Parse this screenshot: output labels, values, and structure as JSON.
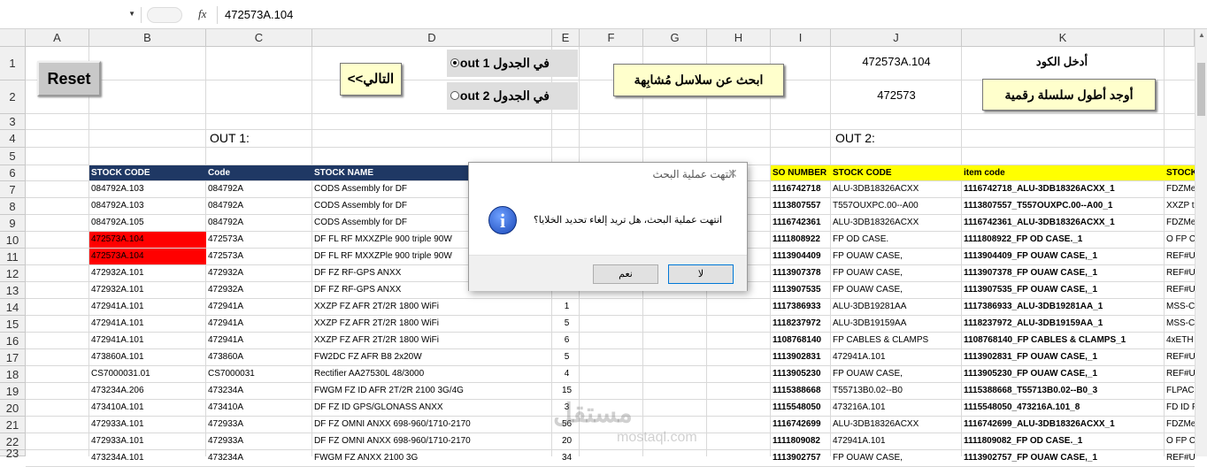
{
  "formula_bar": {
    "name_box": "",
    "fx": "fx",
    "formula": "472573A.104"
  },
  "columns": [
    "A",
    "B",
    "C",
    "D",
    "E",
    "F",
    "G",
    "H",
    "I",
    "J",
    "K"
  ],
  "rows": [
    "1",
    "2",
    "3",
    "4",
    "5",
    "6",
    "7",
    "8",
    "9",
    "10",
    "11",
    "12",
    "13",
    "14",
    "15",
    "16",
    "17",
    "18",
    "19",
    "20",
    "21",
    "22",
    "23"
  ],
  "controls": {
    "reset": "Reset",
    "next": "التالي>>",
    "radio1": "في الجدول out 1",
    "radio2": "في الجدول out 2",
    "search_similar": "ابحث عن سلاسل مُشابِهة",
    "enter_code": "أدخل الكود",
    "find_longest": "أوجد أطول سلسلة رقمية",
    "code_value": "472573A.104",
    "code_digits": "472573"
  },
  "labels": {
    "out1": "OUT 1:",
    "out2": "OUT 2:"
  },
  "out1": {
    "headers": [
      "STOCK CODE",
      "Code",
      "STOCK NAME"
    ],
    "rows": [
      [
        "084792A.103",
        "084792A",
        "CODS Assembly for DF",
        ""
      ],
      [
        "084792A.103",
        "084792A",
        "CODS Assembly for DF",
        ""
      ],
      [
        "084792A.105",
        "084792A",
        "CODS Assembly for DF",
        ""
      ],
      [
        "472573A.104",
        "472573A",
        "DF FL RF MXXZPle 900 triple 90W",
        ""
      ],
      [
        "472573A.104",
        "472573A",
        "DF FL RF MXXZPle 900 triple 90W",
        ""
      ],
      [
        "472932A.101",
        "472932A",
        "DF FZ RF-GPS ANXX",
        ""
      ],
      [
        "472932A.101",
        "472932A",
        "DF FZ RF-GPS ANXX",
        ""
      ],
      [
        "472941A.101",
        "472941A",
        "XXZP FZ AFR 2T/2R 1800 WiFi",
        "1"
      ],
      [
        "472941A.101",
        "472941A",
        "XXZP FZ AFR 2T/2R 1800 WiFi",
        "5"
      ],
      [
        "472941A.101",
        "472941A",
        "XXZP FZ AFR 2T/2R 1800 WiFi",
        "6"
      ],
      [
        "473860A.101",
        "473860A",
        "FW2DC FZ AFR B8 2x20W",
        "5"
      ],
      [
        "CS7000031.01",
        "CS7000031",
        "Rectifier AA27530L 48/3000",
        "4"
      ],
      [
        "473234A.206",
        "473234A",
        "FWGM FZ ID AFR 2T/2R 2100 3G/4G",
        "15"
      ],
      [
        "473410A.101",
        "473410A",
        "DF FZ ID GPS/GLONASS ANXX",
        "3"
      ],
      [
        "472933A.101",
        "472933A",
        "DF FZ OMNI ANXX 698-960/1710-2170",
        "56"
      ],
      [
        "472933A.101",
        "472933A",
        "DF FZ OMNI ANXX 698-960/1710-2170",
        "20"
      ],
      [
        "473234A.101",
        "473234A",
        "FWGM FZ ANXX 2100 3G",
        "34"
      ]
    ]
  },
  "out2": {
    "headers": [
      "SO NUMBER",
      "STOCK CODE",
      "item code",
      "STOCK"
    ],
    "rows": [
      [
        "1116742718",
        "ALU-3DB18326ACXX",
        "1116742718_ALU-3DB18326ACXX_1",
        "FDZMe"
      ],
      [
        "1113807557",
        "T557OUXPC.00--A00",
        "1113807557_T557OUXPC.00--A00_1",
        "XXZP t"
      ],
      [
        "1116742361",
        "ALU-3DB18326ACXX",
        "1116742361_ALU-3DB18326ACXX_1",
        "FDZMe"
      ],
      [
        "1111808922",
        "FP OD CASE.",
        "1111808922_FP OD CASE._1",
        "O FP C"
      ],
      [
        "1113904409",
        "FP OUAW CASE,",
        "1113904409_FP OUAW CASE,_1",
        "REF#U"
      ],
      [
        "1113907378",
        "FP OUAW CASE,",
        "1113907378_FP OUAW CASE,_1",
        "REF#U"
      ],
      [
        "1113907535",
        "FP OUAW CASE,",
        "1113907535_FP OUAW CASE,_1",
        "REF#U"
      ],
      [
        "1117386933",
        "ALU-3DB19281AA",
        "1117386933_ALU-3DB19281AA_1",
        "MSS-C"
      ],
      [
        "1118237972",
        "ALU-3DB19159AA",
        "1118237972_ALU-3DB19159AA_1",
        "MSS-C"
      ],
      [
        "1108768140",
        "FP CABLES & CLAMPS",
        "1108768140_FP CABLES & CLAMPS_1",
        "4xETH"
      ],
      [
        "1113902831",
        "472941A.101",
        "1113902831_FP OUAW CASE,_1",
        "REF#U"
      ],
      [
        "1113905230",
        "FP OUAW CASE,",
        "1113905230_FP OUAW CASE,_1",
        "REF#U"
      ],
      [
        "1115388668",
        "T55713B0.02--B0",
        "1115388668_T55713B0.02--B0_3",
        "FLPAC"
      ],
      [
        "1115548050",
        "473216A.101",
        "1115548050_473216A.101_8",
        "FD ID F"
      ],
      [
        "1116742699",
        "ALU-3DB18326ACXX",
        "1116742699_ALU-3DB18326ACXX_1",
        "FDZMe"
      ],
      [
        "1111809082",
        "472941A.101",
        "1111809082_FP OD CASE._1",
        "O FP C"
      ],
      [
        "1113902757",
        "FP OUAW CASE,",
        "1113902757_FP OUAW CASE,_1",
        "REF#U"
      ]
    ]
  },
  "dialog": {
    "title": "انتهت عملية البحث",
    "message": "انتهت عملية البحث، هل تريد إلغاء تحديد الخلايا؟",
    "yes": "نعم",
    "no": "لا"
  },
  "watermark": {
    "text": "مستقل",
    "sub": "mostaql.com"
  },
  "colors": {
    "header_blue": "#1f3864",
    "header_yellow": "#ffff00",
    "highlight_red": "#ff0000",
    "button_yellow": "#ffffcc"
  }
}
